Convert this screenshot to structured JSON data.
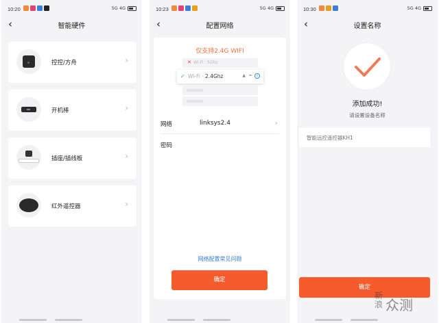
{
  "screens": [
    {
      "status": {
        "time": "10:20",
        "sys": "5G 4G"
      },
      "title": "智能硬件",
      "back_glyph": "‹",
      "items": [
        {
          "label": "控控/方舟"
        },
        {
          "label": "开机棒"
        },
        {
          "label": "插座/插线板"
        },
        {
          "label": "红外遥控器"
        }
      ]
    },
    {
      "status": {
        "time": "10:23",
        "sys": "5G 4G"
      },
      "title": "配置网络",
      "back_glyph": "‹",
      "support_note": "仅支持2.4G  WIFI",
      "wifi_illustration": {
        "row_5g": "Wi-Fi · 5Ghz",
        "row_24g_prefix": "Wi-Fi · ",
        "row_24g_band": "2.4Ghz"
      },
      "network_label": "网络",
      "network_value": "linksys2.4",
      "password_label": "密码",
      "faq_link": "网络配置常见问题",
      "confirm_label": "确定"
    },
    {
      "status": {
        "time": "10:30",
        "sys": "5G 4G"
      },
      "title": "设置名称",
      "back_glyph": "‹",
      "success_title": "添加成功!",
      "success_sub": "请设置设备名称",
      "name_placeholder": "智能远控遥控器KH1",
      "confirm_label": "确定"
    }
  ],
  "watermark": {
    "small": "新\n浪",
    "big": "众测"
  },
  "colors": {
    "accent": "#f55b2c",
    "support_text": "#f2703f",
    "link": "#3a7fd6",
    "check": "#1bb389"
  }
}
